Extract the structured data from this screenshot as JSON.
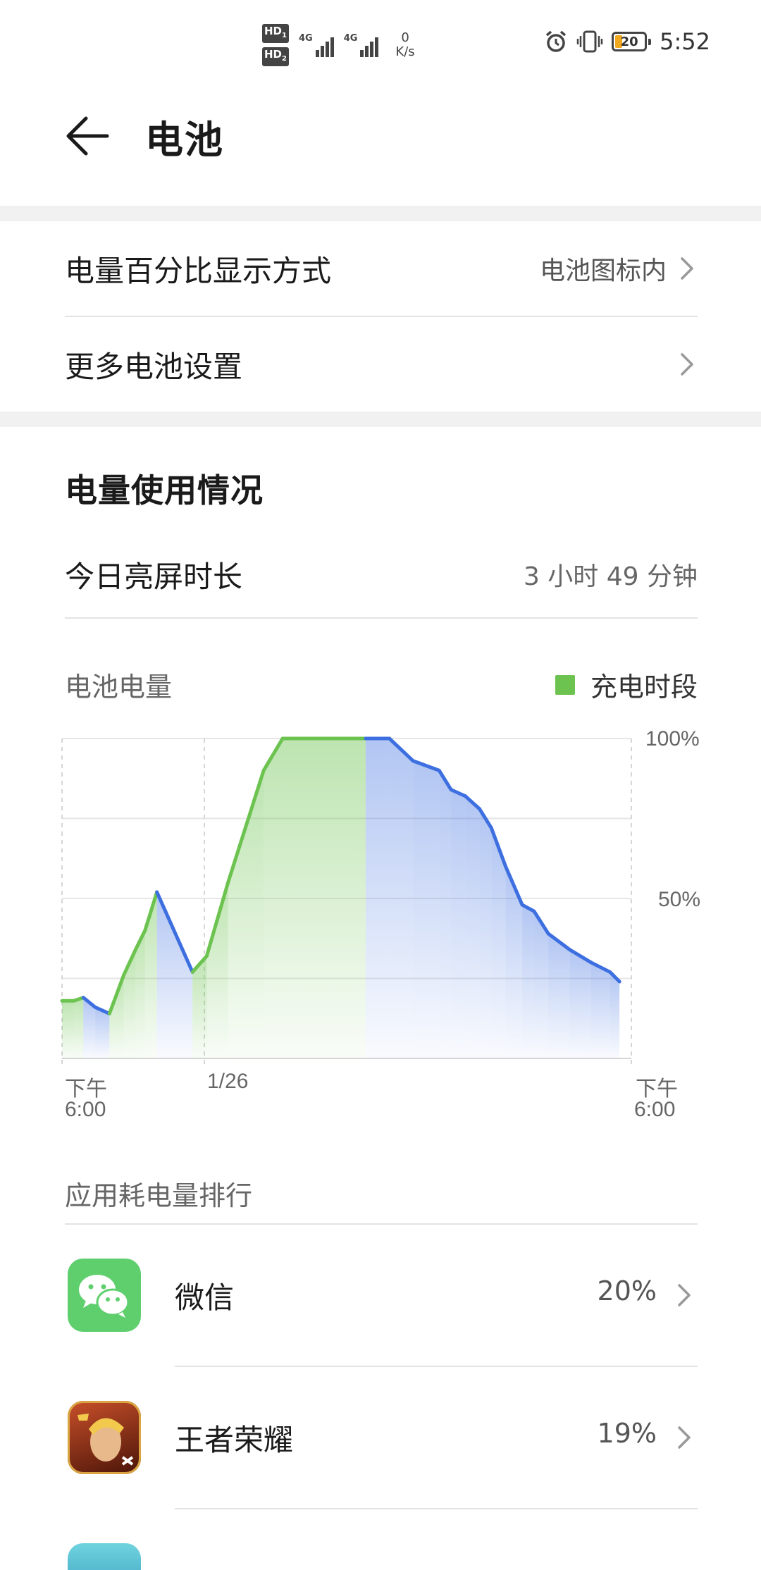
{
  "status_bar": {
    "hd1": "HD",
    "hd1_sub": "1",
    "hd2": "HD",
    "hd2_sub": "2",
    "sim1_type": "4G",
    "sim2_type": "4G",
    "net_speed_value": "0",
    "net_speed_unit": "K/s",
    "battery_level": "20",
    "time": "5:52",
    "alarm_icon": "alarm-clock-icon",
    "vibrate_icon": "vibrate-icon"
  },
  "header": {
    "title": "电池",
    "back_icon": "arrow-left-icon"
  },
  "settings": {
    "percent_display_label": "电量百分比显示方式",
    "percent_display_value": "电池图标内",
    "more_settings_label": "更多电池设置"
  },
  "usage": {
    "section_title": "电量使用情况",
    "screen_time_label": "今日亮屏时长",
    "screen_time_value": "3 小时 49 分钟",
    "chart_label": "电池电量",
    "legend_charging": "充电时段"
  },
  "chart_data": {
    "type": "area",
    "y_ticks": [
      "100%",
      "50%"
    ],
    "ylim": [
      0,
      100
    ],
    "x_tick_labels": [
      {
        "line1": "下午",
        "line2": "6:00"
      },
      {
        "line1": "1/26",
        "line2": ""
      },
      {
        "line1": "下午",
        "line2": "6:00"
      }
    ],
    "xlim_hours": [
      0,
      24
    ],
    "grid": true,
    "colors": {
      "charging": "#6cc350",
      "discharging": "#3d6fe0"
    },
    "series": [
      {
        "x": 0.0,
        "y": 18,
        "state": "discharging"
      },
      {
        "x": 0.5,
        "y": 18,
        "state": "charging"
      },
      {
        "x": 0.9,
        "y": 19,
        "state": "charging"
      },
      {
        "x": 1.4,
        "y": 16,
        "state": "discharging"
      },
      {
        "x": 2.0,
        "y": 14,
        "state": "discharging"
      },
      {
        "x": 2.6,
        "y": 26,
        "state": "charging"
      },
      {
        "x": 3.1,
        "y": 34,
        "state": "charging"
      },
      {
        "x": 3.5,
        "y": 40,
        "state": "charging"
      },
      {
        "x": 4.0,
        "y": 52,
        "state": "charging"
      },
      {
        "x": 5.5,
        "y": 27,
        "state": "discharging"
      },
      {
        "x": 6.1,
        "y": 32,
        "state": "charging"
      },
      {
        "x": 7.0,
        "y": 55,
        "state": "charging"
      },
      {
        "x": 8.5,
        "y": 90,
        "state": "charging"
      },
      {
        "x": 9.3,
        "y": 100,
        "state": "charging"
      },
      {
        "x": 12.8,
        "y": 100,
        "state": "charging"
      },
      {
        "x": 13.8,
        "y": 100,
        "state": "discharging"
      },
      {
        "x": 14.8,
        "y": 93,
        "state": "discharging"
      },
      {
        "x": 15.9,
        "y": 90,
        "state": "discharging"
      },
      {
        "x": 16.4,
        "y": 84,
        "state": "discharging"
      },
      {
        "x": 17.0,
        "y": 82,
        "state": "discharging"
      },
      {
        "x": 17.6,
        "y": 78,
        "state": "discharging"
      },
      {
        "x": 18.1,
        "y": 72,
        "state": "discharging"
      },
      {
        "x": 18.7,
        "y": 60,
        "state": "discharging"
      },
      {
        "x": 19.4,
        "y": 48,
        "state": "discharging"
      },
      {
        "x": 19.9,
        "y": 46,
        "state": "discharging"
      },
      {
        "x": 20.5,
        "y": 39,
        "state": "discharging"
      },
      {
        "x": 21.4,
        "y": 34,
        "state": "discharging"
      },
      {
        "x": 22.3,
        "y": 30,
        "state": "discharging"
      },
      {
        "x": 23.1,
        "y": 27,
        "state": "discharging"
      },
      {
        "x": 23.5,
        "y": 24,
        "state": "discharging"
      }
    ]
  },
  "ranking": {
    "title": "应用耗电量排行",
    "apps": [
      {
        "name": "微信",
        "percent": "20%",
        "icon": "wechat-icon",
        "color": "#5fcf6e"
      },
      {
        "name": "王者荣耀",
        "percent": "19%",
        "icon": "honor-of-kings-icon",
        "color": "#8a2a1a"
      }
    ]
  }
}
